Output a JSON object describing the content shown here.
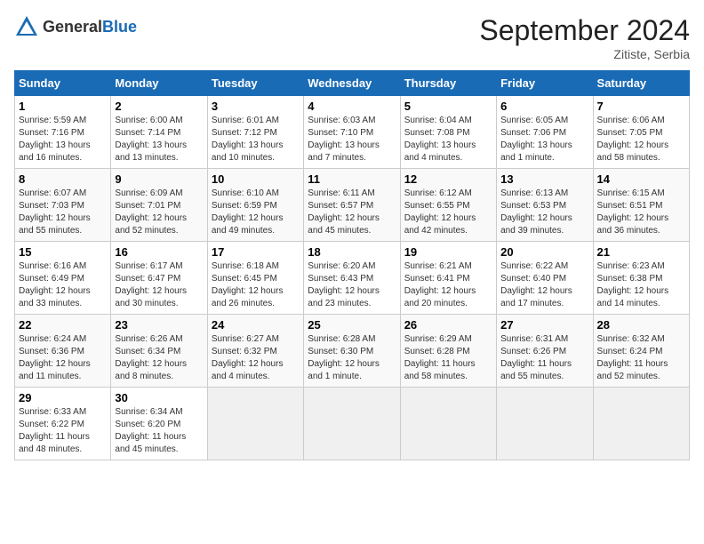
{
  "logo": {
    "general": "General",
    "blue": "Blue"
  },
  "title": "September 2024",
  "location": "Zitiste, Serbia",
  "days_header": [
    "Sunday",
    "Monday",
    "Tuesday",
    "Wednesday",
    "Thursday",
    "Friday",
    "Saturday"
  ],
  "weeks": [
    [
      {
        "day": "1",
        "info": "Sunrise: 5:59 AM\nSunset: 7:16 PM\nDaylight: 13 hours\nand 16 minutes."
      },
      {
        "day": "2",
        "info": "Sunrise: 6:00 AM\nSunset: 7:14 PM\nDaylight: 13 hours\nand 13 minutes."
      },
      {
        "day": "3",
        "info": "Sunrise: 6:01 AM\nSunset: 7:12 PM\nDaylight: 13 hours\nand 10 minutes."
      },
      {
        "day": "4",
        "info": "Sunrise: 6:03 AM\nSunset: 7:10 PM\nDaylight: 13 hours\nand 7 minutes."
      },
      {
        "day": "5",
        "info": "Sunrise: 6:04 AM\nSunset: 7:08 PM\nDaylight: 13 hours\nand 4 minutes."
      },
      {
        "day": "6",
        "info": "Sunrise: 6:05 AM\nSunset: 7:06 PM\nDaylight: 13 hours\nand 1 minute."
      },
      {
        "day": "7",
        "info": "Sunrise: 6:06 AM\nSunset: 7:05 PM\nDaylight: 12 hours\nand 58 minutes."
      }
    ],
    [
      {
        "day": "8",
        "info": "Sunrise: 6:07 AM\nSunset: 7:03 PM\nDaylight: 12 hours\nand 55 minutes."
      },
      {
        "day": "9",
        "info": "Sunrise: 6:09 AM\nSunset: 7:01 PM\nDaylight: 12 hours\nand 52 minutes."
      },
      {
        "day": "10",
        "info": "Sunrise: 6:10 AM\nSunset: 6:59 PM\nDaylight: 12 hours\nand 49 minutes."
      },
      {
        "day": "11",
        "info": "Sunrise: 6:11 AM\nSunset: 6:57 PM\nDaylight: 12 hours\nand 45 minutes."
      },
      {
        "day": "12",
        "info": "Sunrise: 6:12 AM\nSunset: 6:55 PM\nDaylight: 12 hours\nand 42 minutes."
      },
      {
        "day": "13",
        "info": "Sunrise: 6:13 AM\nSunset: 6:53 PM\nDaylight: 12 hours\nand 39 minutes."
      },
      {
        "day": "14",
        "info": "Sunrise: 6:15 AM\nSunset: 6:51 PM\nDaylight: 12 hours\nand 36 minutes."
      }
    ],
    [
      {
        "day": "15",
        "info": "Sunrise: 6:16 AM\nSunset: 6:49 PM\nDaylight: 12 hours\nand 33 minutes."
      },
      {
        "day": "16",
        "info": "Sunrise: 6:17 AM\nSunset: 6:47 PM\nDaylight: 12 hours\nand 30 minutes."
      },
      {
        "day": "17",
        "info": "Sunrise: 6:18 AM\nSunset: 6:45 PM\nDaylight: 12 hours\nand 26 minutes."
      },
      {
        "day": "18",
        "info": "Sunrise: 6:20 AM\nSunset: 6:43 PM\nDaylight: 12 hours\nand 23 minutes."
      },
      {
        "day": "19",
        "info": "Sunrise: 6:21 AM\nSunset: 6:41 PM\nDaylight: 12 hours\nand 20 minutes."
      },
      {
        "day": "20",
        "info": "Sunrise: 6:22 AM\nSunset: 6:40 PM\nDaylight: 12 hours\nand 17 minutes."
      },
      {
        "day": "21",
        "info": "Sunrise: 6:23 AM\nSunset: 6:38 PM\nDaylight: 12 hours\nand 14 minutes."
      }
    ],
    [
      {
        "day": "22",
        "info": "Sunrise: 6:24 AM\nSunset: 6:36 PM\nDaylight: 12 hours\nand 11 minutes."
      },
      {
        "day": "23",
        "info": "Sunrise: 6:26 AM\nSunset: 6:34 PM\nDaylight: 12 hours\nand 8 minutes."
      },
      {
        "day": "24",
        "info": "Sunrise: 6:27 AM\nSunset: 6:32 PM\nDaylight: 12 hours\nand 4 minutes."
      },
      {
        "day": "25",
        "info": "Sunrise: 6:28 AM\nSunset: 6:30 PM\nDaylight: 12 hours\nand 1 minute."
      },
      {
        "day": "26",
        "info": "Sunrise: 6:29 AM\nSunset: 6:28 PM\nDaylight: 11 hours\nand 58 minutes."
      },
      {
        "day": "27",
        "info": "Sunrise: 6:31 AM\nSunset: 6:26 PM\nDaylight: 11 hours\nand 55 minutes."
      },
      {
        "day": "28",
        "info": "Sunrise: 6:32 AM\nSunset: 6:24 PM\nDaylight: 11 hours\nand 52 minutes."
      }
    ],
    [
      {
        "day": "29",
        "info": "Sunrise: 6:33 AM\nSunset: 6:22 PM\nDaylight: 11 hours\nand 48 minutes."
      },
      {
        "day": "30",
        "info": "Sunrise: 6:34 AM\nSunset: 6:20 PM\nDaylight: 11 hours\nand 45 minutes."
      },
      {
        "day": "",
        "info": ""
      },
      {
        "day": "",
        "info": ""
      },
      {
        "day": "",
        "info": ""
      },
      {
        "day": "",
        "info": ""
      },
      {
        "day": "",
        "info": ""
      }
    ]
  ]
}
